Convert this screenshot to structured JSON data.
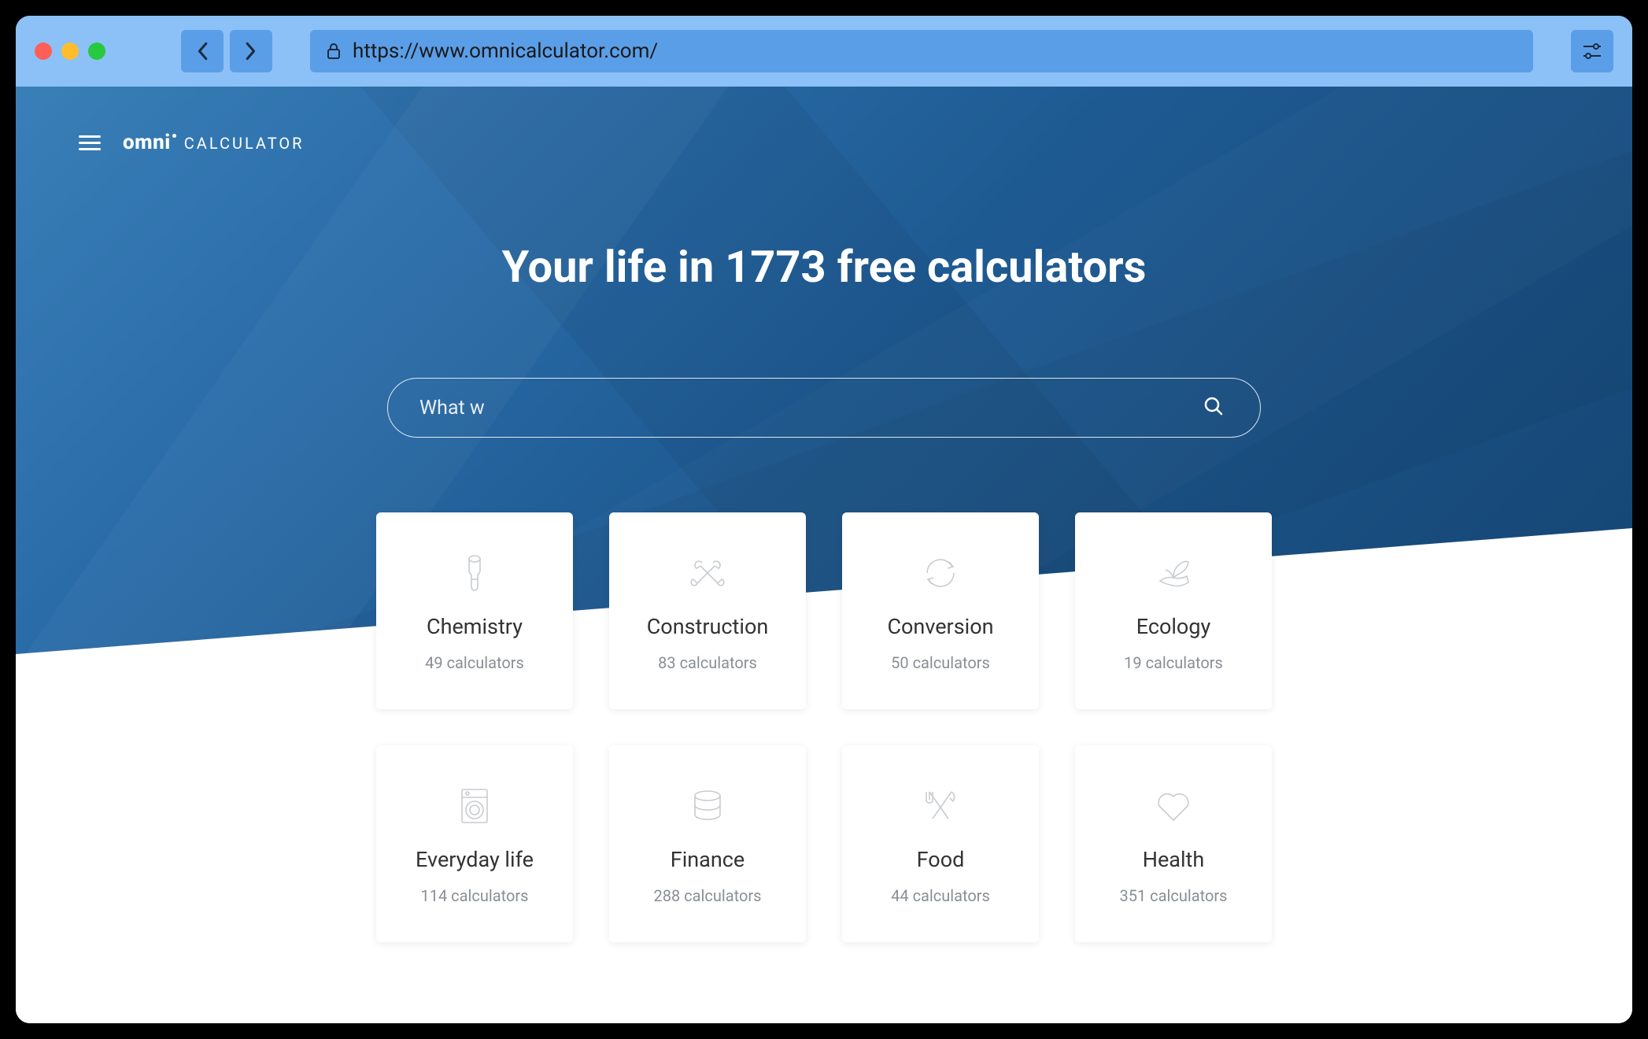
{
  "browser": {
    "url": "https://www.omnicalculator.com/"
  },
  "logo": {
    "brand": "omni",
    "suffix": "CALCULATOR"
  },
  "headline": "Your life in 1773 free calculators",
  "search": {
    "placeholder": "What w"
  },
  "categories": [
    {
      "name": "Chemistry",
      "count": "49 calculators",
      "icon": "chemistry-icon"
    },
    {
      "name": "Construction",
      "count": "83 calculators",
      "icon": "construction-icon"
    },
    {
      "name": "Conversion",
      "count": "50 calculators",
      "icon": "conversion-icon"
    },
    {
      "name": "Ecology",
      "count": "19 calculators",
      "icon": "ecology-icon"
    },
    {
      "name": "Everyday life",
      "count": "114 calculators",
      "icon": "everyday-icon"
    },
    {
      "name": "Finance",
      "count": "288 calculators",
      "icon": "finance-icon"
    },
    {
      "name": "Food",
      "count": "44 calculators",
      "icon": "food-icon"
    },
    {
      "name": "Health",
      "count": "351 calculators",
      "icon": "health-icon"
    }
  ]
}
